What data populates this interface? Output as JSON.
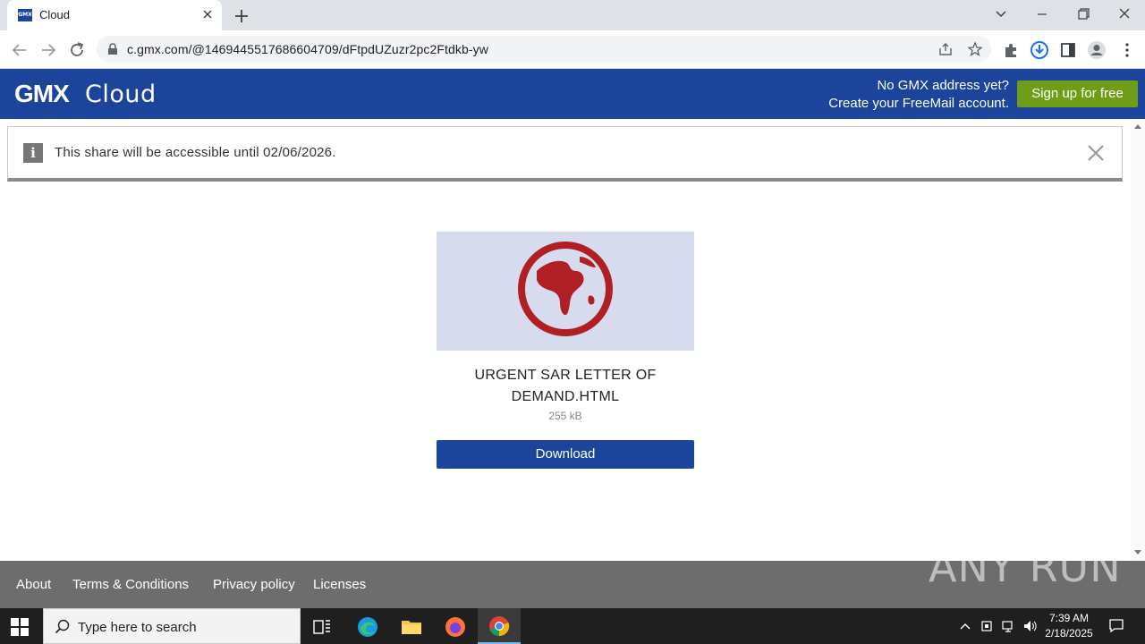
{
  "browser": {
    "tab_title": "Cloud",
    "favicon_text": "GMX",
    "url": "c.gmx.com/@1469445517686604709/dFtpdUZuzr2pc2Ftdkb-yw"
  },
  "header": {
    "logo": "GMX",
    "product": "Cloud",
    "promo_line1": "No GMX address yet?",
    "promo_line2": "Create your FreeMail account.",
    "signup_label": "Sign up for free"
  },
  "notice": {
    "text": "This share will be accessible until 02/06/2026.",
    "icon": "info-icon"
  },
  "file": {
    "name_line1": "URGENT SAR LETTER OF",
    "name_line2": "DEMAND.HTML",
    "size": "255 kB",
    "download_label": "Download",
    "thumbnail_icon": "globe-icon"
  },
  "footer": {
    "links": [
      "About",
      "Terms & Conditions",
      "Privacy policy",
      "Licenses"
    ],
    "watermark": "ANY RUN"
  },
  "taskbar": {
    "search_placeholder": "Type here to search",
    "time": "7:39 AM",
    "date": "2/18/2025"
  },
  "colors": {
    "brand_blue": "#1c449b",
    "signup_green": "#6f9d17",
    "globe_red": "#b01f24",
    "thumb_bg": "#d6dced"
  }
}
